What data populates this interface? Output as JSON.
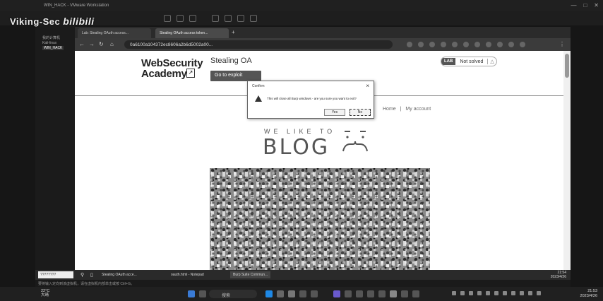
{
  "watermark": {
    "channel": "Viking-Sec",
    "brand": "bilibili"
  },
  "host_window": {
    "title": "WIN_HACK - VMware Workstation"
  },
  "vm_sidebar": {
    "items": [
      "我的计算机",
      "Kali-linux",
      "WIN_HACK"
    ],
    "selected": "WIN_HACK"
  },
  "browser": {
    "tabs": [
      {
        "label": "Lab: Stealing OAuth access...",
        "active": false
      },
      {
        "label": "Stealing OAuth access token...",
        "active": true
      }
    ],
    "address": "0a6100a104372ec8606a2b6d5002a00..."
  },
  "lab_header": {
    "logo_line1": "WebSecurity",
    "logo_line2": "Academy",
    "title": "Stealing OA",
    "exploit_button": "Go to exploit",
    "status_badge": "LAB",
    "status": "Not solved"
  },
  "page_nav": {
    "home": "Home",
    "separator": "|",
    "account": "My account"
  },
  "blog": {
    "subtitle": "WE LIKE TO",
    "title": "BLOG"
  },
  "dialog": {
    "title": "Confirm",
    "message": "This will close all Burp windows - are you sure you want to exit?",
    "yes": "Yes",
    "no": "No"
  },
  "guest_taskbar": {
    "search": "????????",
    "tasks": [
      {
        "label": "Stealing OAuth acce...",
        "active": false
      },
      {
        "label": "oauth.html - Notepad",
        "active": false
      },
      {
        "label": "Burp Suite Commun...",
        "active": true
      }
    ],
    "time": "21:54",
    "date": "2023/4/26"
  },
  "vm_status": "要将输入定向到该虚拟机，请在虚拟机内部单击或按 Ctrl+G。",
  "host_taskbar": {
    "temperature": "22°C",
    "weather": "大晴",
    "search": "搜索",
    "time": "21:53",
    "date": "2023/4/26"
  },
  "colors": {
    "accent": "#555555",
    "page_bg": "#ffffff",
    "chrome_dark": "#202020"
  }
}
